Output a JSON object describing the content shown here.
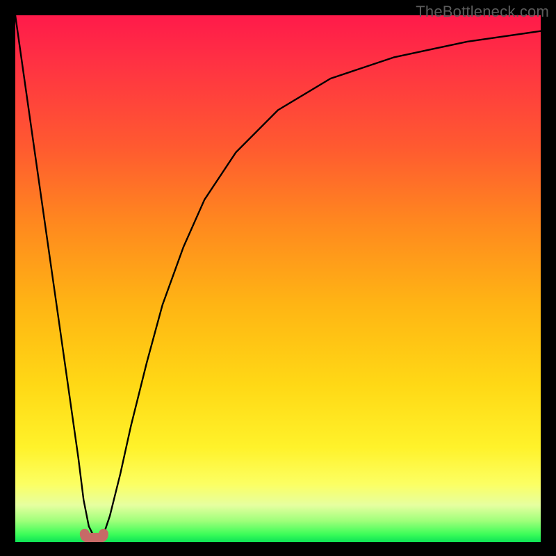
{
  "watermark": "TheBottleneck.com",
  "chart_data": {
    "type": "line",
    "title": "",
    "xlabel": "",
    "ylabel": "",
    "xlim": [
      0,
      100
    ],
    "ylim": [
      0,
      100
    ],
    "grid": false,
    "legend": false,
    "series": [
      {
        "name": "bottleneck-curve",
        "x": [
          0,
          4,
          8,
          12,
          13,
          14,
          15,
          16,
          17,
          18,
          20,
          22,
          25,
          28,
          32,
          36,
          42,
          50,
          60,
          72,
          86,
          100
        ],
        "y": [
          100,
          72,
          44,
          16,
          8,
          3,
          1,
          1,
          2,
          5,
          13,
          22,
          34,
          45,
          56,
          65,
          74,
          82,
          88,
          92,
          95,
          97
        ]
      }
    ],
    "marker": {
      "name": "optimum-marker",
      "x_range": [
        13.2,
        16.8
      ],
      "y": 0.8,
      "color": "#c76a67"
    },
    "background_gradient": {
      "top": "#ff1a4a",
      "mid": "#ffd815",
      "bottom": "#0de356"
    }
  }
}
